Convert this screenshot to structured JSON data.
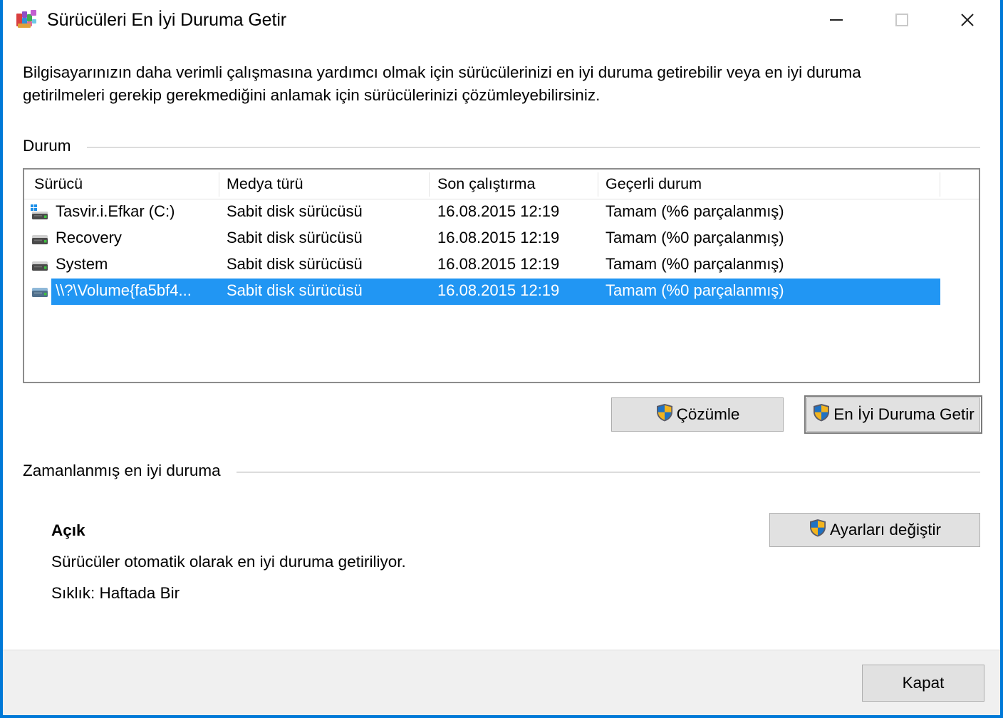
{
  "window": {
    "title": "Sürücüleri En İyi Duruma Getir",
    "icon": "defragmenter-icon",
    "accent_color": "#0078d7",
    "controls": {
      "minimize": "minimize-icon",
      "maximize": "maximize-icon",
      "close": "close-icon"
    }
  },
  "description": "Bilgisayarınızın daha verimli çalışmasına yardımcı olmak için sürücülerinizi en iyi duruma getirebilir veya en iyi duruma getirilmeleri gerekip gerekmediğini anlamak için sürücülerinizi çözümleyebilirsiniz.",
  "status_group": {
    "label": "Durum",
    "table": {
      "columns": [
        "Sürücü",
        "Medya türü",
        "Son çalıştırma",
        "Geçerli durum"
      ],
      "rows": [
        {
          "drive": "Tasvir.i.Efkar (C:)",
          "media": "Sabit disk sürücüsü",
          "last_run": "16.08.2015 12:19",
          "current_status": "Tamam (%6 parçalanmış)",
          "icon": "system-drive-icon",
          "selected": false
        },
        {
          "drive": "Recovery",
          "media": "Sabit disk sürücüsü",
          "last_run": "16.08.2015 12:19",
          "current_status": "Tamam (%0 parçalanmış)",
          "icon": "drive-icon",
          "selected": false
        },
        {
          "drive": "System",
          "media": "Sabit disk sürücüsü",
          "last_run": "16.08.2015 12:19",
          "current_status": "Tamam (%0 parçalanmış)",
          "icon": "drive-icon",
          "selected": false
        },
        {
          "drive": "\\\\?\\Volume{fa5bf4...",
          "media": "Sabit disk sürücüsü",
          "last_run": "16.08.2015 12:19",
          "current_status": "Tamam (%0 parçalanmış)",
          "icon": "drive-icon",
          "selected": true
        }
      ],
      "selection_color": "#2196f3"
    },
    "buttons": {
      "analyze": "Çözümle",
      "optimize": "En İyi Duruma Getir",
      "shield_icon": "uac-shield-icon"
    }
  },
  "schedule_group": {
    "label": "Zamanlanmış en iyi duruma",
    "state": "Açık",
    "detail": "Sürücüler otomatik olarak en iyi duruma getiriliyor.",
    "frequency": "Sıklık: Haftada Bir",
    "change_settings_button": "Ayarları değiştir",
    "shield_icon": "uac-shield-icon"
  },
  "footer": {
    "close_button": "Kapat"
  }
}
